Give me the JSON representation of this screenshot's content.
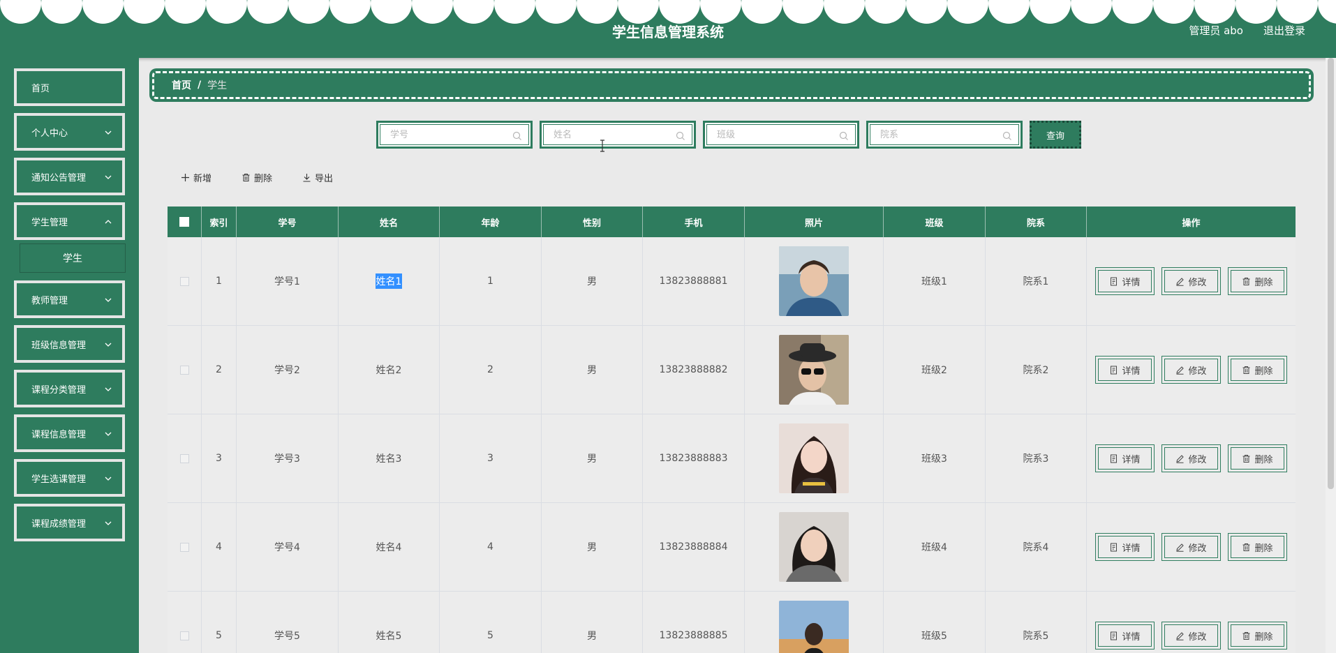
{
  "header": {
    "title": "学生信息管理系统",
    "user": "管理员 abo",
    "logout": "退出登录"
  },
  "sidebar": {
    "items": [
      {
        "label": "首页",
        "expandable": false
      },
      {
        "label": "个人中心",
        "expandable": true
      },
      {
        "label": "通知公告管理",
        "expandable": true
      },
      {
        "label": "学生管理",
        "expandable": true
      },
      {
        "label": "教师管理",
        "expandable": true
      },
      {
        "label": "班级信息管理",
        "expandable": true
      },
      {
        "label": "课程分类管理",
        "expandable": true
      },
      {
        "label": "课程信息管理",
        "expandable": true
      },
      {
        "label": "学生选课管理",
        "expandable": true
      },
      {
        "label": "课程成绩管理",
        "expandable": true
      }
    ],
    "submenu": {
      "label": "学生"
    }
  },
  "breadcrumb": {
    "home": "首页",
    "separator": "/",
    "current": "学生"
  },
  "search": {
    "fields": [
      {
        "placeholder": "学号",
        "value": ""
      },
      {
        "placeholder": "姓名",
        "value": ""
      },
      {
        "placeholder": "班级",
        "value": ""
      },
      {
        "placeholder": "院系",
        "value": ""
      }
    ],
    "query_label": "查询"
  },
  "actions": {
    "add": "新增",
    "delete": "删除",
    "export": "导出"
  },
  "table": {
    "columns": [
      "索引",
      "学号",
      "姓名",
      "年龄",
      "性别",
      "手机",
      "照片",
      "班级",
      "院系",
      "操作"
    ],
    "rows": [
      {
        "index": "1",
        "student_no": "学号1",
        "name": "姓名1",
        "age": "1",
        "gender": "男",
        "phone": "13823888881",
        "photo": "photo-1",
        "class": "班级1",
        "dept": "院系1"
      },
      {
        "index": "2",
        "student_no": "学号2",
        "name": "姓名2",
        "age": "2",
        "gender": "男",
        "phone": "13823888882",
        "photo": "photo-2",
        "class": "班级2",
        "dept": "院系2"
      },
      {
        "index": "3",
        "student_no": "学号3",
        "name": "姓名3",
        "age": "3",
        "gender": "男",
        "phone": "13823888883",
        "photo": "photo-3",
        "class": "班级3",
        "dept": "院系3"
      },
      {
        "index": "4",
        "student_no": "学号4",
        "name": "姓名4",
        "age": "4",
        "gender": "男",
        "phone": "13823888884",
        "photo": "photo-4",
        "class": "班级4",
        "dept": "院系4"
      },
      {
        "index": "5",
        "student_no": "学号5",
        "name": "姓名5",
        "age": "5",
        "gender": "男",
        "phone": "13823888885",
        "photo": "photo-5",
        "class": "班级5",
        "dept": "院系5"
      }
    ],
    "row_actions": {
      "detail": "详情",
      "edit": "修改",
      "delete": "删除"
    },
    "selected_text_row": 0
  },
  "colors": {
    "primary": "#2e7c5e",
    "background": "#eaeaea",
    "selection": "#3390ff"
  }
}
